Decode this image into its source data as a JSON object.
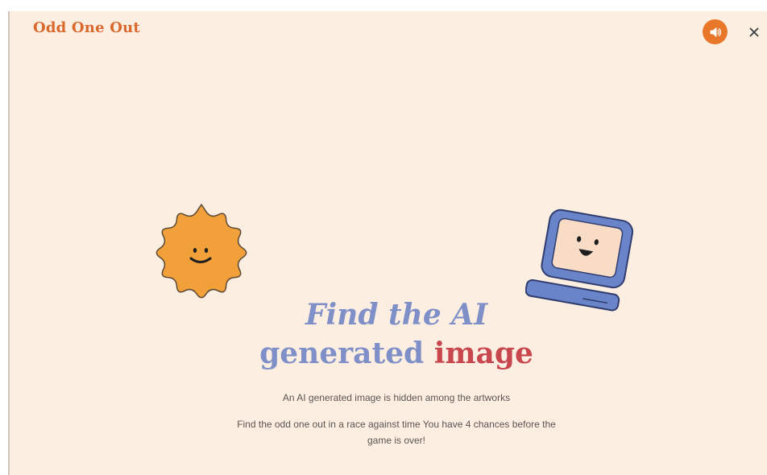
{
  "header": {
    "title": "Odd One Out",
    "sound_icon": "speaker-icon",
    "close_icon": "close-icon"
  },
  "main": {
    "headline_line1": "Find the AI",
    "headline_generated": "generated",
    "headline_image": "image",
    "description_line1": "An AI generated image is hidden among the artworks",
    "description_line2": "Find the odd one out in a race against time You have 4 chances before the game is over!"
  },
  "illustrations": {
    "left": "smiling-sun-icon",
    "right": "smiling-computer-icon"
  },
  "colors": {
    "background": "#fdeee2",
    "accent": "#e8772a",
    "title": "#d9692c",
    "headline_blue": "#7f8fc7",
    "headline_red": "#c8464e",
    "sun": "#f2a13a",
    "computer_blue": "#6a84c9",
    "screen": "#f9dcc5"
  }
}
